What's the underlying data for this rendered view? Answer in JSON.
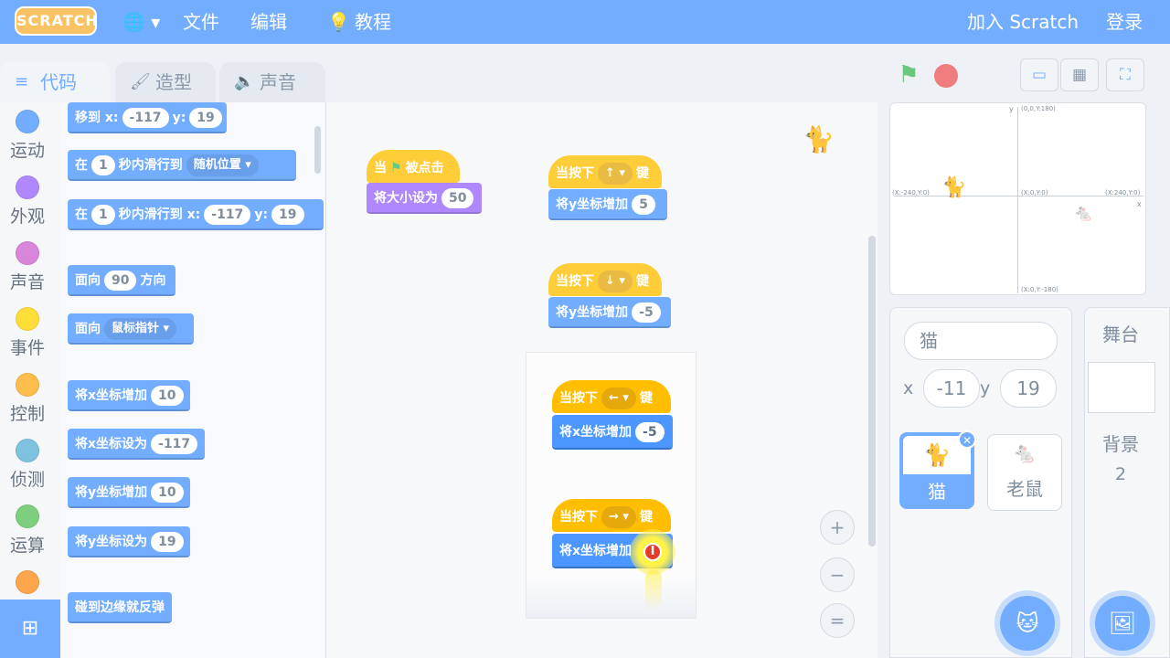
{
  "menubar": {
    "logo": "SCRATCH",
    "globe": "🌐 ▾",
    "file": "文件",
    "edit": "编辑",
    "tutorials": "教程",
    "join": "加入 Scratch",
    "signin": "登录"
  },
  "tabs": {
    "code": "代码",
    "costumes": "造型",
    "sounds": "声音"
  },
  "categories": [
    {
      "label": "运动",
      "color": "#4c97ff"
    },
    {
      "label": "外观",
      "color": "#9966ff"
    },
    {
      "label": "声音",
      "color": "#cf63cf"
    },
    {
      "label": "事件",
      "color": "#ffd500"
    },
    {
      "label": "控制",
      "color": "#ffab19"
    },
    {
      "label": "侦测",
      "color": "#5cb1d6"
    },
    {
      "label": "运算",
      "color": "#59c059"
    },
    {
      "label": "",
      "color": "#ff8c1a"
    }
  ],
  "palette": {
    "goto": {
      "a": "移到 x:",
      "x": "-117",
      "b": "y:",
      "y": "19"
    },
    "glide_random": {
      "a": "在",
      "n": "1",
      "b": "秒内滑行到",
      "d": "随机位置 ▾"
    },
    "glide_xy": {
      "a": "在",
      "n": "1",
      "b": "秒内滑行到 x:",
      "x": "-117",
      "c": "y:",
      "y": "19"
    },
    "point_dir": {
      "a": "面向",
      "v": "90",
      "b": "方向"
    },
    "point_towards": {
      "a": "面向",
      "d": "鼠标指针 ▾"
    },
    "change_x": {
      "a": "将x坐标增加",
      "v": "10"
    },
    "set_x": {
      "a": "将x坐标设为",
      "v": "-117"
    },
    "change_y": {
      "a": "将y坐标增加",
      "v": "10"
    },
    "set_y": {
      "a": "将y坐标设为",
      "v": "19"
    },
    "bounce": {
      "a": "碰到边缘就反弹"
    }
  },
  "scripts": {
    "flag_hat": {
      "a": "当",
      "b": "被点击"
    },
    "set_size": {
      "a": "将大小设为",
      "v": "50"
    },
    "up_hat": {
      "a": "当按下",
      "k": "↑ ▾",
      "b": "键"
    },
    "up_change": {
      "a": "将y坐标增加",
      "v": "5"
    },
    "down_hat": {
      "a": "当按下",
      "k": "↓ ▾",
      "b": "键"
    },
    "down_change": {
      "a": "将y坐标增加",
      "v": "-5"
    },
    "left_hat": {
      "a": "当按下",
      "k": "← ▾",
      "b": "键"
    },
    "left_change": {
      "a": "将x坐标增加",
      "v": "-5"
    },
    "right_hat": {
      "a": "当按下",
      "k": "→ ▾",
      "b": "键"
    },
    "right_change": {
      "a": "将x坐标增加",
      "v": "I"
    }
  },
  "zoom": {
    "in": "+",
    "out": "−",
    "reset": "="
  },
  "stage_labels": {
    "top": "(0,0,Y:180)",
    "left": "(X:-240,Y:0)",
    "center": "(X:0,Y:0)",
    "right": "(X:240,Y:0)",
    "bottom": "(X:0,Y:-180)",
    "y_axis": "y",
    "x_axis": "x"
  },
  "sprite": {
    "name": "猫",
    "x_label": "x",
    "x": "-11",
    "y_label": "y",
    "y": "19"
  },
  "sprites": [
    {
      "name": "猫",
      "selected": true
    },
    {
      "name": "老鼠",
      "selected": false
    }
  ],
  "stage_panel": {
    "title": "舞台",
    "backdrops_label": "背景",
    "backdrops_count": "2"
  },
  "colors": {
    "motion": "#4c97ff",
    "looks": "#9966ff",
    "events": "#ffbf00",
    "menubar": "#4c97ff"
  }
}
